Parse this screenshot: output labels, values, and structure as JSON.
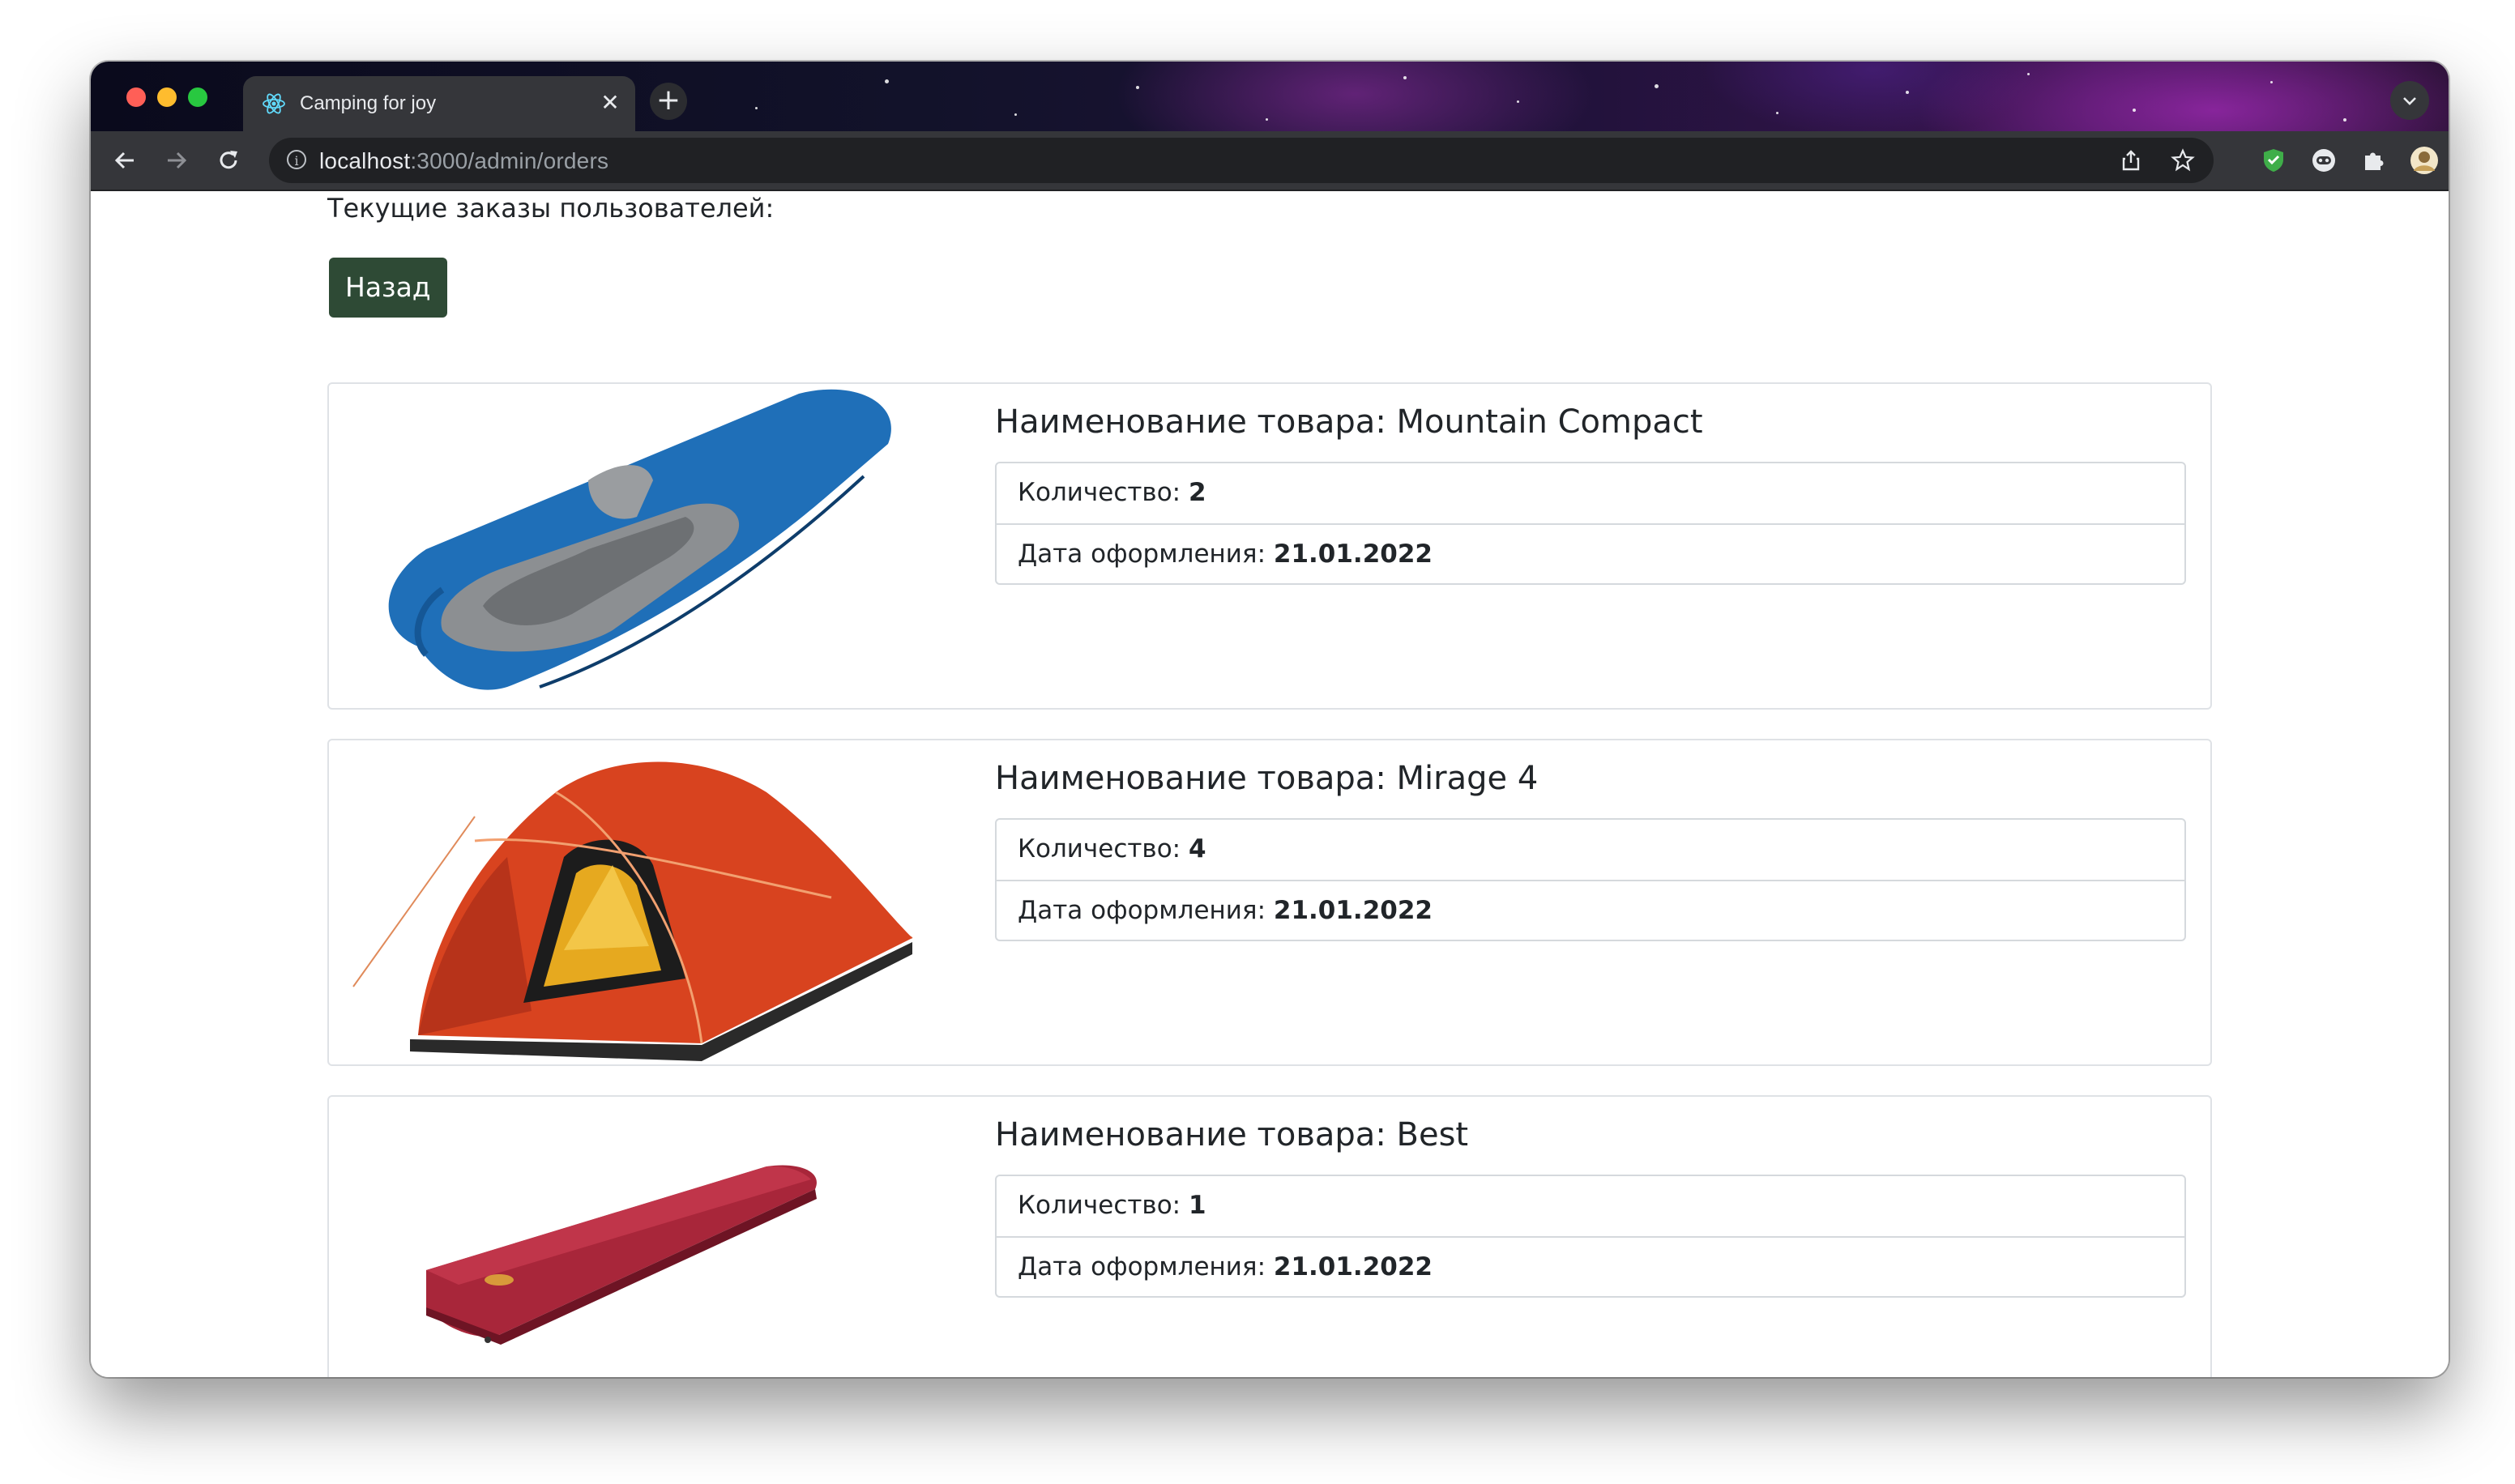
{
  "browser": {
    "tab_title": "Camping for joy",
    "url_host": "localhost",
    "url_path": ":3000/admin/orders"
  },
  "page": {
    "heading": "Текущие заказы пользователей:",
    "back_button": "Назад"
  },
  "orders": [
    {
      "name_label": "Наименование товара: ",
      "name": "Mountain Compact",
      "qty_label": "Количество: ",
      "qty": "2",
      "date_label": "Дата оформления: ",
      "date": "21.01.2022",
      "image": "sleeping-bag"
    },
    {
      "name_label": "Наименование товара: ",
      "name": "Mirage 4",
      "qty_label": "Количество: ",
      "qty": "4",
      "date_label": "Дата оформления: ",
      "date": "21.01.2022",
      "image": "tent"
    },
    {
      "name_label": "Наименование товара: ",
      "name": "Best",
      "qty_label": "Количество: ",
      "qty": "1",
      "date_label": "Дата оформления: ",
      "date": "21.01.2022",
      "image": "sleeping-mat"
    }
  ],
  "colors": {
    "back_button_bg": "#2e4a35",
    "sleeping_bag": "#1f6fb8",
    "tent": "#d8431f",
    "mat": "#a8263a"
  }
}
